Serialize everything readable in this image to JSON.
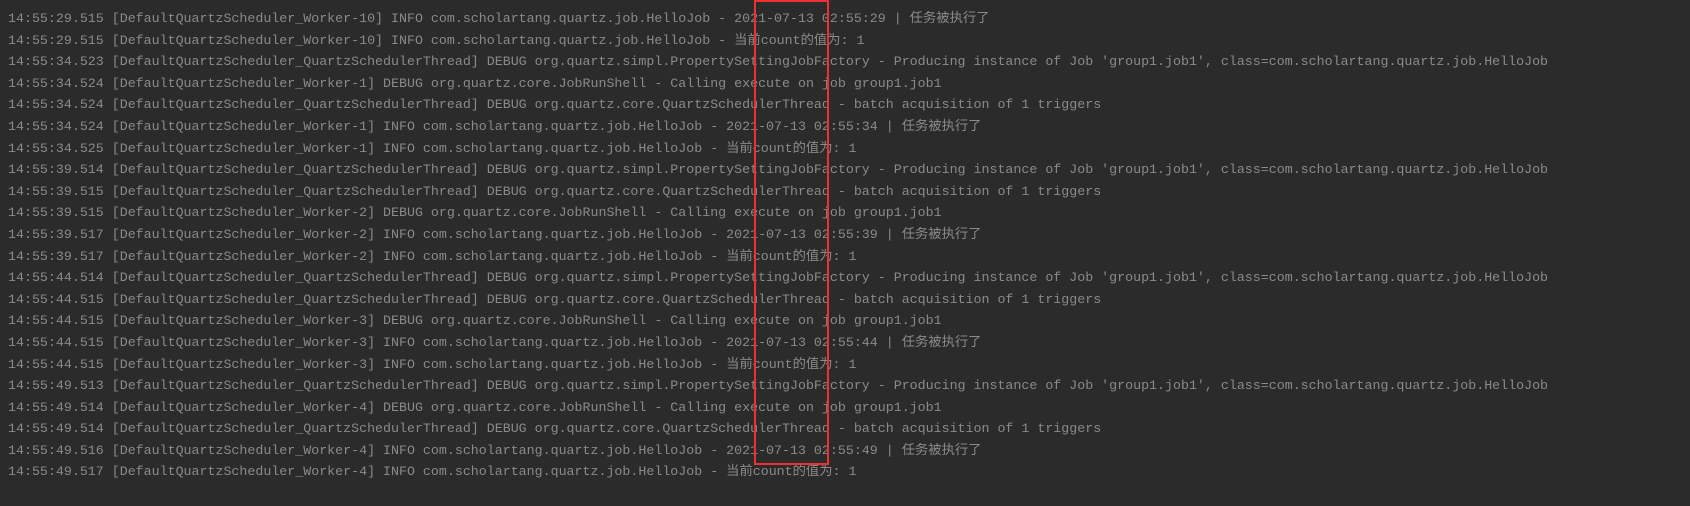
{
  "logs": [
    "14:55:29.515 [DefaultQuartzScheduler_Worker-10] INFO com.scholartang.quartz.job.HelloJob - 2021-07-13 02:55:29 | 任务被执行了",
    "14:55:29.515 [DefaultQuartzScheduler_Worker-10] INFO com.scholartang.quartz.job.HelloJob - 当前count的值为: 1",
    "14:55:34.523 [DefaultQuartzScheduler_QuartzSchedulerThread] DEBUG org.quartz.simpl.PropertySettingJobFactory - Producing instance of Job 'group1.job1', class=com.scholartang.quartz.job.HelloJob",
    "14:55:34.524 [DefaultQuartzScheduler_Worker-1] DEBUG org.quartz.core.JobRunShell - Calling execute on job group1.job1",
    "14:55:34.524 [DefaultQuartzScheduler_QuartzSchedulerThread] DEBUG org.quartz.core.QuartzSchedulerThread - batch acquisition of 1 triggers",
    "14:55:34.524 [DefaultQuartzScheduler_Worker-1] INFO com.scholartang.quartz.job.HelloJob - 2021-07-13 02:55:34 | 任务被执行了",
    "14:55:34.525 [DefaultQuartzScheduler_Worker-1] INFO com.scholartang.quartz.job.HelloJob - 当前count的值为: 1",
    "14:55:39.514 [DefaultQuartzScheduler_QuartzSchedulerThread] DEBUG org.quartz.simpl.PropertySettingJobFactory - Producing instance of Job 'group1.job1', class=com.scholartang.quartz.job.HelloJob",
    "14:55:39.515 [DefaultQuartzScheduler_QuartzSchedulerThread] DEBUG org.quartz.core.QuartzSchedulerThread - batch acquisition of 1 triggers",
    "14:55:39.515 [DefaultQuartzScheduler_Worker-2] DEBUG org.quartz.core.JobRunShell - Calling execute on job group1.job1",
    "14:55:39.517 [DefaultQuartzScheduler_Worker-2] INFO com.scholartang.quartz.job.HelloJob - 2021-07-13 02:55:39 | 任务被执行了",
    "14:55:39.517 [DefaultQuartzScheduler_Worker-2] INFO com.scholartang.quartz.job.HelloJob - 当前count的值为: 1",
    "14:55:44.514 [DefaultQuartzScheduler_QuartzSchedulerThread] DEBUG org.quartz.simpl.PropertySettingJobFactory - Producing instance of Job 'group1.job1', class=com.scholartang.quartz.job.HelloJob",
    "14:55:44.515 [DefaultQuartzScheduler_QuartzSchedulerThread] DEBUG org.quartz.core.QuartzSchedulerThread - batch acquisition of 1 triggers",
    "14:55:44.515 [DefaultQuartzScheduler_Worker-3] DEBUG org.quartz.core.JobRunShell - Calling execute on job group1.job1",
    "14:55:44.515 [DefaultQuartzScheduler_Worker-3] INFO com.scholartang.quartz.job.HelloJob - 2021-07-13 02:55:44 | 任务被执行了",
    "14:55:44.515 [DefaultQuartzScheduler_Worker-3] INFO com.scholartang.quartz.job.HelloJob - 当前count的值为: 1",
    "14:55:49.513 [DefaultQuartzScheduler_QuartzSchedulerThread] DEBUG org.quartz.simpl.PropertySettingJobFactory - Producing instance of Job 'group1.job1', class=com.scholartang.quartz.job.HelloJob",
    "14:55:49.514 [DefaultQuartzScheduler_Worker-4] DEBUG org.quartz.core.JobRunShell - Calling execute on job group1.job1",
    "14:55:49.514 [DefaultQuartzScheduler_QuartzSchedulerThread] DEBUG org.quartz.core.QuartzSchedulerThread - batch acquisition of 1 triggers",
    "14:55:49.516 [DefaultQuartzScheduler_Worker-4] INFO com.scholartang.quartz.job.HelloJob - 2021-07-13 02:55:49 | 任务被执行了",
    "14:55:49.517 [DefaultQuartzScheduler_Worker-4] INFO com.scholartang.quartz.job.HelloJob - 当前count的值为: 1"
  ]
}
